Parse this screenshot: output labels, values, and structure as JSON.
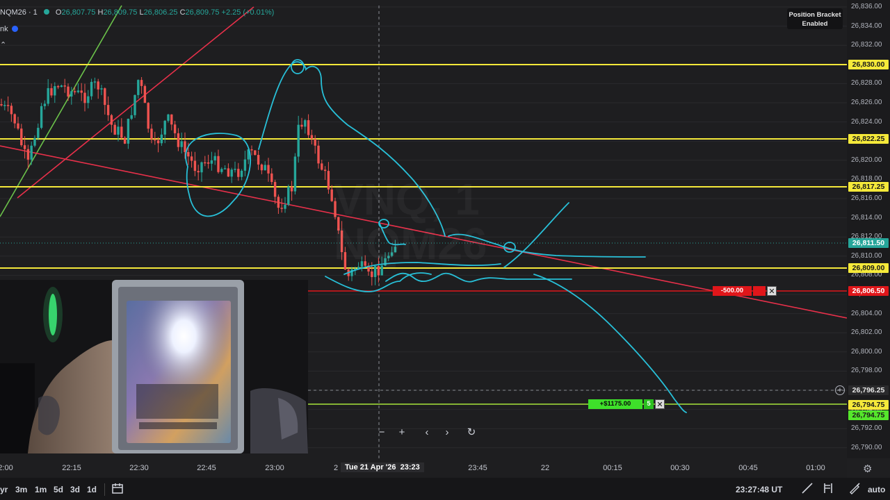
{
  "legend": {
    "symbol": "NQM26 · 1",
    "open_label": "O",
    "open": "26,807.75",
    "high_label": "H",
    "high": "26,809.75",
    "low_label": "L",
    "low": "26,806.25",
    "close_label": "C",
    "close": "26,809.75",
    "change": "+2.25 (+0.01%)",
    "sub_label": "nk"
  },
  "position_bracket": {
    "line1": "Position Bracket",
    "line2": "Enabled"
  },
  "watermark": {
    "line1": "VNQ, 1",
    "line2": "NQM26"
  },
  "price_axis": {
    "ticks": [
      "26,836.00",
      "26,834.00",
      "26,832.00",
      "26,830.00",
      "26,828.00",
      "26,826.00",
      "26,824.00",
      "26,822.00",
      "26,820.00",
      "26,818.00",
      "26,816.00",
      "26,814.00",
      "26,812.00",
      "26,810.00",
      "26,808.00",
      "26,806.00",
      "26,804.00",
      "26,802.00",
      "26,800.00",
      "26,798.00",
      "26,796.00",
      "26,794.00",
      "26,792.00",
      "26,790.00"
    ],
    "level_tags": [
      "26,830.00",
      "26,822.25",
      "26,817.25",
      "26,809.00"
    ],
    "current_price": "26,811.50",
    "stop_price": "26,806.50",
    "crosshair_price": "26,796.25",
    "target_price": "26,794.75",
    "target_price_2": "26,794.75"
  },
  "orders": {
    "stop_label": "-500.00",
    "target_label": "+$1175.00",
    "target_qty": "5",
    "close_symbol": "✕"
  },
  "time_axis": {
    "labels": [
      "2:00",
      "22:15",
      "22:30",
      "22:45",
      "23:00",
      "23:45",
      "22",
      "00:15",
      "00:30",
      "00:45",
      "01:00"
    ],
    "cursor_prefix": "2",
    "cursor_label": "Tue 21 Apr '26",
    "cursor_time": "23:23"
  },
  "chart_nav": {
    "zoom_out": "−",
    "zoom_in": "+",
    "scroll_left": "‹",
    "scroll_right": "›",
    "reset": "↻"
  },
  "toolbar": {
    "ranges": [
      "yr",
      "3m",
      "1m",
      "5d",
      "3d",
      "1d"
    ],
    "clock": "23:27:48 UT",
    "auto": "auto"
  },
  "colors": {
    "up": "#26a69a",
    "down": "#ef5350",
    "level_line": "#f5e93a",
    "trend_red": "#e8304a",
    "trend_green": "#6bc24a",
    "drawing": "#28c0d8",
    "stop_red": "#e0161a",
    "target_lime": "#55e62b"
  },
  "icons": {
    "settings": "gear-icon",
    "date_range": "calendar-icon",
    "crosshair": "crosshair-plus-icon",
    "drawing_tools": [
      "trendline-icon",
      "fork-icon",
      "brush-icon"
    ]
  }
}
